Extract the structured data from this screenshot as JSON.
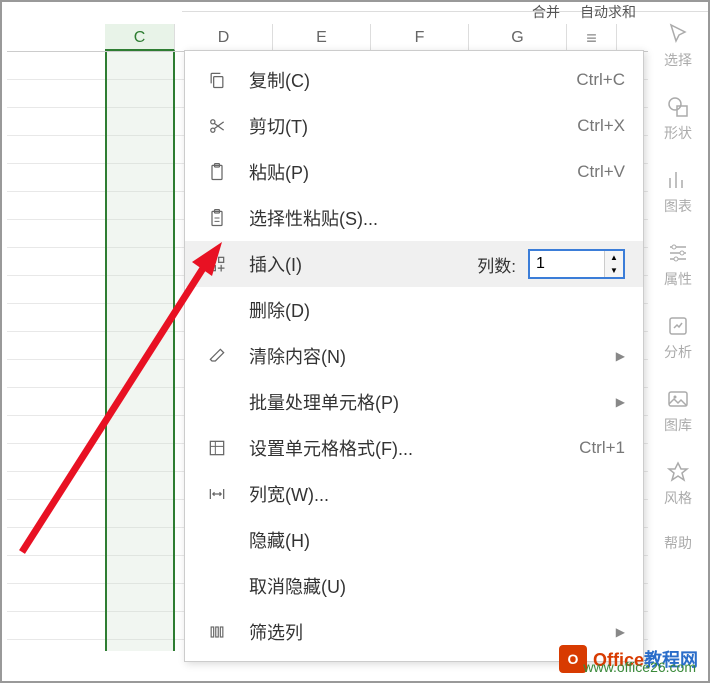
{
  "top": {
    "hint1": "合并",
    "hint2": "自动求和"
  },
  "columns": [
    "C",
    "D",
    "E",
    "F",
    "G"
  ],
  "selected_column": "C",
  "sidebar": {
    "items": [
      {
        "label": "选择"
      },
      {
        "label": "形状"
      },
      {
        "label": "图表"
      },
      {
        "label": "属性"
      },
      {
        "label": "分析"
      },
      {
        "label": "图库"
      },
      {
        "label": "风格"
      },
      {
        "label": "帮助"
      }
    ]
  },
  "menu": {
    "copy": {
      "label": "复制(C)",
      "shortcut": "Ctrl+C"
    },
    "cut": {
      "label": "剪切(T)",
      "shortcut": "Ctrl+X"
    },
    "paste": {
      "label": "粘贴(P)",
      "shortcut": "Ctrl+V"
    },
    "paste_special": {
      "label": "选择性粘贴(S)..."
    },
    "insert": {
      "label": "插入(I)",
      "count_label": "列数:",
      "count_value": "1"
    },
    "delete": {
      "label": "删除(D)"
    },
    "clear": {
      "label": "清除内容(N)"
    },
    "batch": {
      "label": "批量处理单元格(P)"
    },
    "format_cells": {
      "label": "设置单元格格式(F)...",
      "shortcut": "Ctrl+1"
    },
    "col_width": {
      "label": "列宽(W)..."
    },
    "hide": {
      "label": "隐藏(H)"
    },
    "unhide": {
      "label": "取消隐藏(U)"
    },
    "filter": {
      "label": "筛选列"
    }
  },
  "watermark": {
    "brand1": "Office",
    "brand2": "教程网",
    "url": "www.office26.com"
  }
}
